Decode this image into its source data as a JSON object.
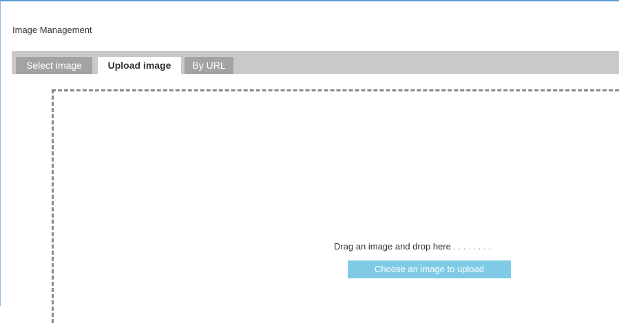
{
  "window": {
    "title": "Image Management"
  },
  "tabs": [
    {
      "label": "Select image",
      "active": false
    },
    {
      "label": "Upload image",
      "active": true
    },
    {
      "label": "By URL",
      "active": false
    }
  ],
  "upload": {
    "drop_text": "Drag an image and drop here",
    "drop_dots": " . . . . . . . .",
    "button_label": "Choose an image to upload"
  },
  "colors": {
    "accent_border": "#5b9bd5",
    "tab_strip": "#c9c9c9",
    "inactive_tab": "#a3a3a3",
    "upload_button": "#7fcbe6"
  }
}
